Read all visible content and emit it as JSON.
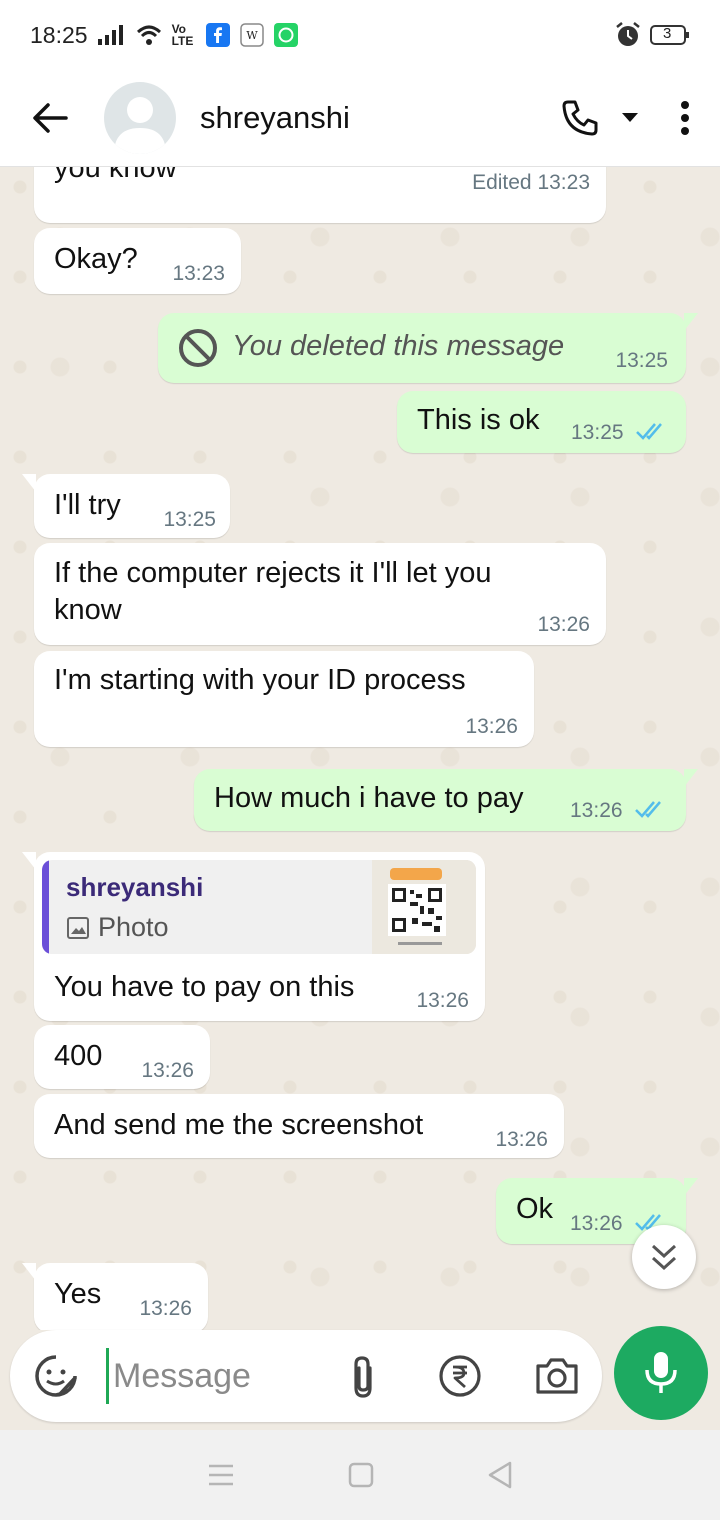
{
  "status_bar": {
    "time": "18:25",
    "network_label": "Vo LTE",
    "battery": "3"
  },
  "header": {
    "contact_name": "shreyanshi"
  },
  "messages": [
    {
      "direction": "in",
      "text": "you know",
      "time": "Edited 13:23"
    },
    {
      "direction": "in",
      "text": "Okay?",
      "time": "13:23"
    },
    {
      "direction": "out",
      "text": "You deleted this message",
      "time": "13:25",
      "deleted": true
    },
    {
      "direction": "out",
      "text": "This is ok",
      "time": "13:25",
      "read": true
    },
    {
      "direction": "in",
      "text": "I'll try",
      "time": "13:25"
    },
    {
      "direction": "in",
      "text_line1": "If the computer rejects it I'll let you",
      "text_line2": "know",
      "time": "13:26"
    },
    {
      "direction": "in",
      "text": "I'm starting with your ID process",
      "time": "13:26"
    },
    {
      "direction": "out",
      "text": "How much i have to pay",
      "time": "13:26",
      "read": true
    },
    {
      "direction": "in",
      "reply_to_name": "shreyanshi",
      "reply_to_type": "Photo",
      "text": "You have to pay on this",
      "time": "13:26"
    },
    {
      "direction": "in",
      "text": "400",
      "time": "13:26"
    },
    {
      "direction": "in",
      "text": "And send me the screenshot",
      "time": "13:26"
    },
    {
      "direction": "out",
      "text": "Ok",
      "time": "13:26",
      "read": true
    },
    {
      "direction": "in",
      "text": "Yes",
      "time": "13:26"
    }
  ],
  "composer": {
    "placeholder": "Message"
  },
  "colors": {
    "outgoing_bubble": "#d9fdd3",
    "incoming_bubble": "#ffffff",
    "read_ticks": "#53bdeb",
    "accent_green": "#1daa61",
    "quote_bar": "#6b4fd8"
  },
  "icons": {
    "back": "arrow-left-icon",
    "call": "phone-icon",
    "menu": "more-vertical-icon",
    "emoji": "sticker-icon",
    "attach": "paperclip-icon",
    "payment": "rupee-icon",
    "camera": "camera-icon",
    "mic": "mic-icon",
    "scroll": "chevrons-down-icon"
  }
}
